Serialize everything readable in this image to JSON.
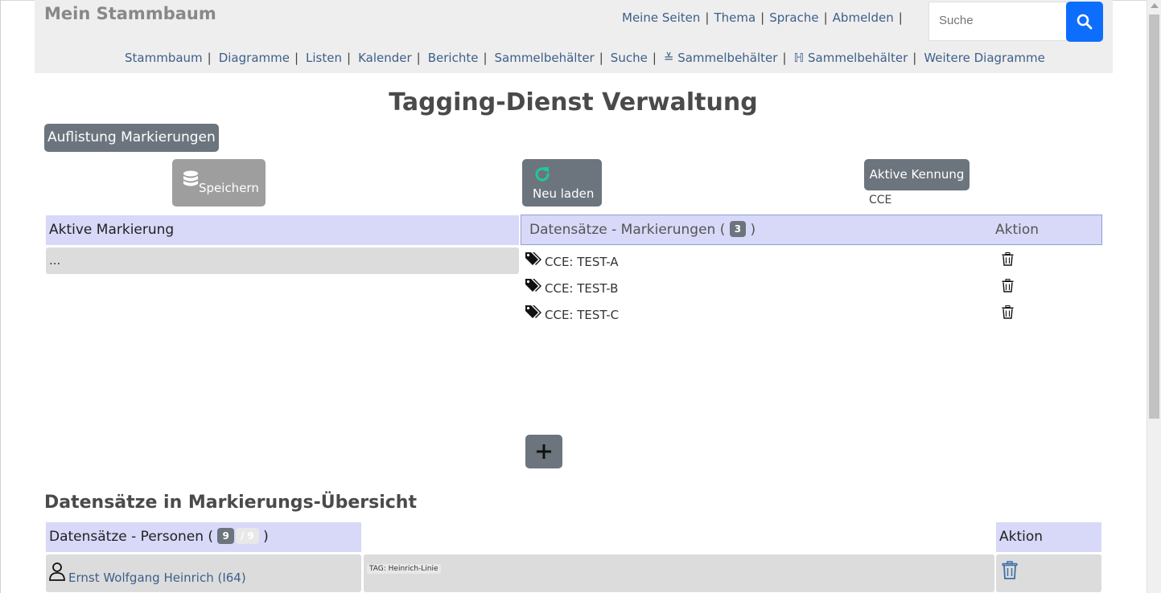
{
  "header": {
    "brand": "Mein Stammbaum",
    "top_links": [
      "Meine Seiten",
      "Thema",
      "Sprache",
      "Abmelden"
    ],
    "search_placeholder": "Suche",
    "main_links": [
      "Stammbaum",
      "Diagramme",
      "Listen",
      "Kalender",
      "Berichte",
      "Sammelbehälter",
      "Suche",
      "≚ Sammelbehälter",
      "ℍ Sammelbehälter",
      "Weitere Diagramme"
    ],
    "separator": "|"
  },
  "page": {
    "title": "Tagging-Dienst Verwaltung",
    "list_button": "Auflistung Markierungen",
    "save_button": "Speichern",
    "reload_button": "Neu laden",
    "active_id_button": "Aktive Kennung",
    "active_id_value": "CCE"
  },
  "active_tag": {
    "header": "Aktive Markierung",
    "value": "..."
  },
  "records_tags": {
    "header_prefix": "Datensätze - Markierungen (",
    "count": "3",
    "header_suffix": ")",
    "action_header": "Aktion",
    "items": [
      "CCE: TEST-A",
      "CCE: TEST-B",
      "CCE: TEST-C"
    ]
  },
  "overview": {
    "title": "Datensätze in Markierungs-Übersicht",
    "persons_header_prefix": "Datensätze - Personen (",
    "persons_count": "9",
    "persons_total": "/ 9",
    "persons_header_suffix": ")",
    "action_header": "Aktion",
    "rows": [
      {
        "name": "Ernst Wolfgang Heinrich (I64)",
        "tag": "TAG: Heinrich-Linie"
      }
    ]
  },
  "colors": {
    "header_bg": "#eeeeee",
    "link": "#3d5f8a",
    "primary": "#0d6efd",
    "secondary": "#6c757d",
    "table_header_bg": "#d8d8f8",
    "row_bg": "#dcdcdc",
    "reload_icon": "#20c997",
    "trash_outline": "#3d6fa8"
  },
  "icons": [
    "search-icon",
    "database-icon",
    "refresh-icon",
    "tags-icon",
    "trash-icon",
    "plus-icon",
    "person-icon"
  ]
}
